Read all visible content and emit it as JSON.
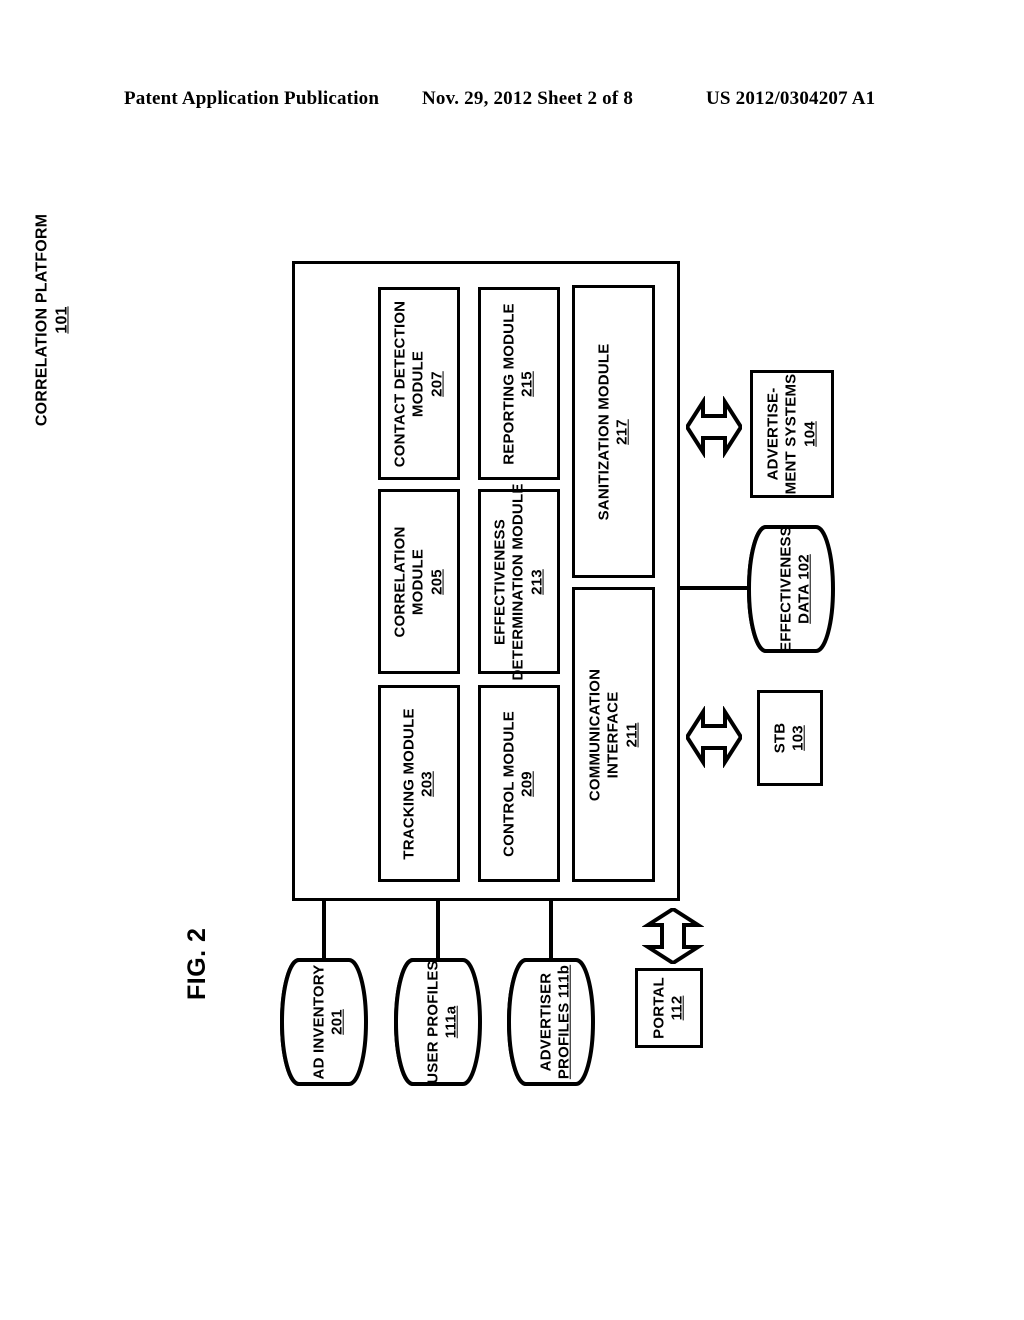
{
  "header": {
    "publication": "Patent Application Publication",
    "date_sheet": "Nov. 29, 2012  Sheet 2 of 8",
    "patent_number": "US 2012/0304207 A1"
  },
  "figure": {
    "label": "FIG. 2"
  },
  "diagram": {
    "platform": {
      "title": "CORRELATION PLATFORM",
      "ref": "101"
    },
    "modules": [
      {
        "name": "tracking-module",
        "label": "TRACKING MODULE",
        "ref": "203"
      },
      {
        "name": "correlation-module",
        "label": "CORRELATION\nMODULE",
        "line1": "CORRELATION",
        "line2": "MODULE",
        "ref": "205"
      },
      {
        "name": "contact-detection-module",
        "label": "CONTACT DETECTION\nMODULE",
        "line1": "CONTACT DETECTION",
        "line2": "MODULE",
        "ref": "207"
      },
      {
        "name": "control-module",
        "label": "CONTROL MODULE",
        "ref": "209"
      },
      {
        "name": "effectiveness-determination-module",
        "label": "EFFECTIVENESS\nDETERMINATION MODULE",
        "line1": "EFFECTIVENESS",
        "line2": "DETERMINATION MODULE",
        "ref": "213"
      },
      {
        "name": "reporting-module",
        "label": "REPORTING MODULE",
        "ref": "215"
      },
      {
        "name": "communication-interface",
        "label": "COMMUNICATION\nINTERFACE",
        "line1": "COMMUNICATION",
        "line2": "INTERFACE",
        "ref": "211"
      },
      {
        "name": "sanitization-module",
        "label": "SANITIZATION MODULE",
        "ref": "217"
      }
    ],
    "external": [
      {
        "name": "advertisement-systems",
        "line1": "ADVERTISE-",
        "line2": "MENT SYSTEMS",
        "ref": "104"
      },
      {
        "name": "stb",
        "label": "STB",
        "ref": "103"
      },
      {
        "name": "portal",
        "label": "PORTAL",
        "ref": "112"
      }
    ],
    "datastores": [
      {
        "name": "ad-inventory",
        "line1": "AD INVENTORY",
        "line2": "",
        "ref": "201"
      },
      {
        "name": "user-profiles",
        "line1": "USER PROFILES",
        "line2": "",
        "ref": "111a"
      },
      {
        "name": "advertiser-profiles",
        "line1": "ADVERTISER",
        "line2": "PROFILES 111b",
        "ref": "111b"
      },
      {
        "name": "effectiveness-data",
        "line1": "EFFECTIVENESS",
        "line2": "DATA 102",
        "ref": "102"
      }
    ],
    "arrows": [
      {
        "name": "arrow-advertisement-systems",
        "direction": "bidirectional-horizontal"
      },
      {
        "name": "arrow-stb",
        "direction": "bidirectional-horizontal"
      },
      {
        "name": "arrow-portal",
        "direction": "bidirectional-vertical"
      }
    ],
    "colors": {
      "stroke": "#000000",
      "fill": "#ffffff"
    }
  }
}
